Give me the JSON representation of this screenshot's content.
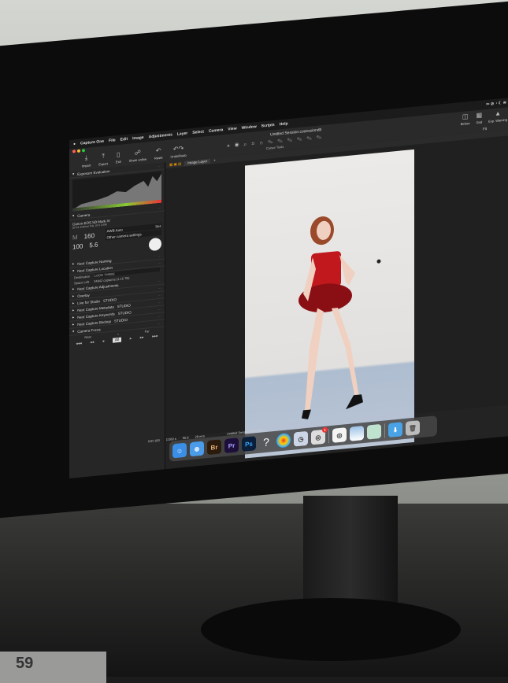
{
  "menubar": {
    "app": "Capture One",
    "items": [
      "File",
      "Edit",
      "Image",
      "Adjustments",
      "Layer",
      "Select",
      "Camera",
      "View",
      "Window",
      "Scripts",
      "Help"
    ]
  },
  "toolbar": {
    "buttons": [
      "Import",
      "Export",
      "Exit",
      "Share online",
      "Reset",
      "Undo/Redo"
    ],
    "title": "Untitled Session.cosessiondb",
    "cursor_tools": "Cursor Tools",
    "right": [
      "Before",
      "Grid",
      "Exp. Warning"
    ],
    "fit": "Fit"
  },
  "panel": {
    "exposure": "Exposure Evaluation",
    "camera": {
      "header": "Camera",
      "model": "Canon EOS 5D Mark IV",
      "lens": "EF24-105mm f/4L IS II USM",
      "mode": "M",
      "shutter": "160",
      "iso": "100",
      "aperture": "5.6",
      "wb": "AWB Auto",
      "set": "Set",
      "other": "Other camera settings"
    },
    "sections": [
      "Next Capture Naming",
      "Next Capture Location"
    ],
    "destination_label": "Destination",
    "destination": "LOOK THREE",
    "space_label": "Space Left",
    "space": "34842 captures (1.15 TB)",
    "more_sections": [
      "Next Capture Adjustments",
      "Overlay",
      "Live for Studio",
      "Next Capture Metadata",
      "Next Capture Keywords",
      "Next Capture Backup",
      "Camera Focus"
    ],
    "studio_tag": "STUDIO",
    "focus": {
      "near": "Near",
      "far": "Far",
      "all": "All"
    }
  },
  "viewer": {
    "layer": "Image Layer",
    "meta": [
      "ISO 100",
      "1/160 s",
      "f/5.6",
      "28 mm"
    ],
    "filename": "Untitled Session1157.JPG"
  },
  "dock": {
    "apps": [
      "Finder",
      "Safari",
      "Br",
      "Pr",
      "Ps",
      "Help",
      "DaVinci Resolve",
      "Clock",
      "Capture One",
      "Capture One Alt",
      "Preview",
      "Photo App",
      "Downloads",
      "Trash"
    ],
    "badge": "1"
  }
}
